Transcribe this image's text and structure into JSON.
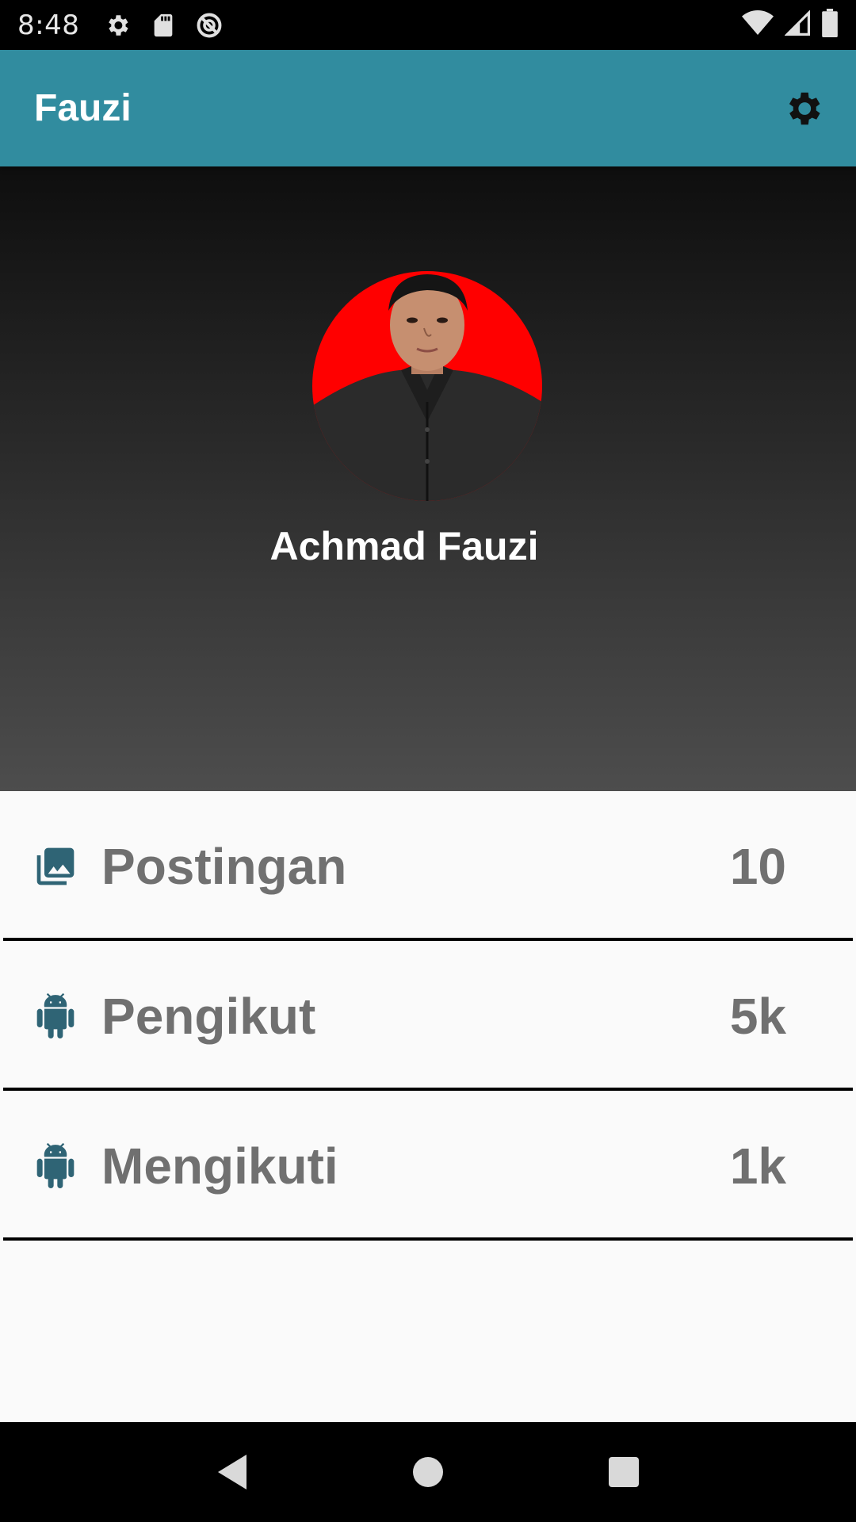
{
  "status_bar": {
    "time": "8:48",
    "left_icons": [
      "gear-icon",
      "sd-card-icon",
      "sync-disabled-icon"
    ],
    "right_icons": [
      "wifi-icon",
      "cellular-signal-icon",
      "battery-icon"
    ]
  },
  "app_bar": {
    "title": "Fauzi",
    "settings_icon": "gear-icon"
  },
  "profile": {
    "name": "Achmad Fauzi",
    "avatar_bg_color": "#ff0000"
  },
  "stats": [
    {
      "icon": "photo-library-icon",
      "label": "Postingan",
      "value": "10"
    },
    {
      "icon": "android-icon",
      "label": "Pengikut",
      "value": "5k"
    },
    {
      "icon": "android-icon",
      "label": "Mengikuti",
      "value": "1k"
    }
  ],
  "nav_bar": {
    "buttons": [
      "back-icon",
      "home-icon",
      "recents-icon"
    ]
  },
  "colors": {
    "app_bar": "#318c9f",
    "icon_tint": "#2f6475",
    "stat_text": "#707070"
  }
}
